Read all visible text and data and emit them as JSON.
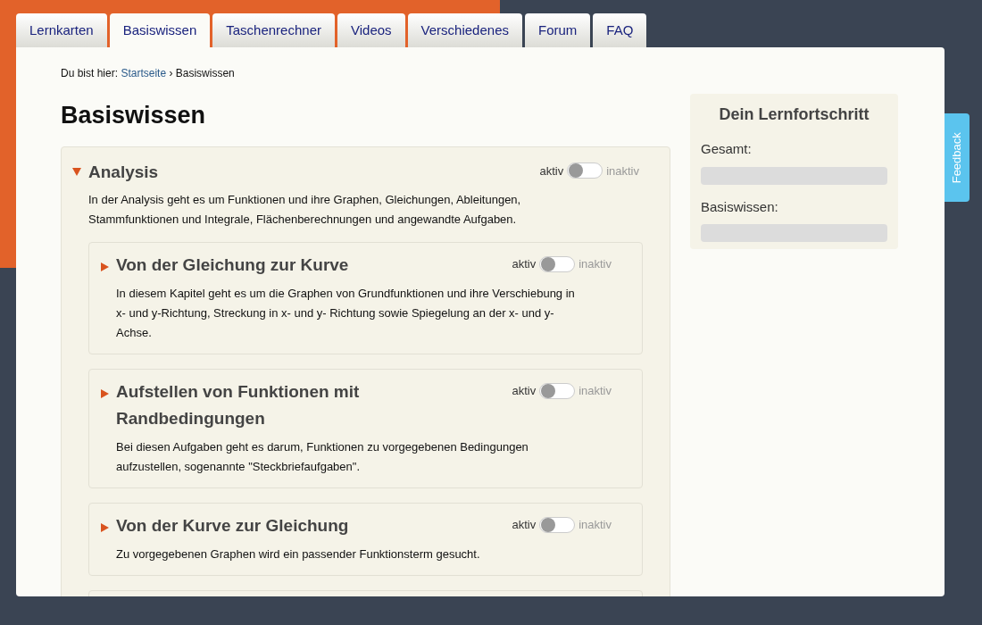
{
  "tabs": [
    {
      "label": "Lernkarten",
      "selected": false
    },
    {
      "label": "Basiswissen",
      "selected": true
    },
    {
      "label": "Taschenrechner",
      "selected": false
    },
    {
      "label": "Videos",
      "selected": false
    },
    {
      "label": "Verschiedenes",
      "selected": false
    },
    {
      "label": "Forum",
      "selected": false
    },
    {
      "label": "FAQ",
      "selected": false
    }
  ],
  "breadcrumb": {
    "prefix": "Du bist hier:",
    "link": "Startseite",
    "separator": "›",
    "current": "Basiswissen"
  },
  "heading": "Basiswissen",
  "topic": {
    "title": "Analysis",
    "expanded": true,
    "toggle": {
      "on_label": "aktiv",
      "off_label": "inaktiv",
      "on": false
    },
    "description": "In der Analysis geht es um Funktionen und ihre Graphen, Gleichungen, Ableitungen, Stammfunktionen und Integrale, Flächenberechnungen und angewandte Aufgaben.",
    "children": [
      {
        "title": "Von der Gleichung zur Kurve",
        "expanded": false,
        "toggle": {
          "on_label": "aktiv",
          "off_label": "inaktiv",
          "on": false
        },
        "description": "In diesem Kapitel geht es um die Graphen von Grundfunktionen und ihre Verschiebung in x- und y-Richtung, Streckung in x- und y- Richtung sowie Spiegelung an der x- und y-Achse."
      },
      {
        "title": "Aufstellen von Funktionen mit Randbedingungen",
        "expanded": false,
        "toggle": {
          "on_label": "aktiv",
          "off_label": "inaktiv",
          "on": false
        },
        "description": "Bei diesen Aufgaben geht es darum, Funktionen zu vorgegebenen Bedingungen aufzustellen, sogenannte \"Steckbriefaufgaben\"."
      },
      {
        "title": "Von der Kurve zur Gleichung",
        "expanded": false,
        "toggle": {
          "on_label": "aktiv",
          "off_label": "inaktiv",
          "on": false
        },
        "description": "Zu vorgegebenen Graphen wird ein passender Funktionsterm gesucht."
      }
    ]
  },
  "progress": {
    "title": "Dein Lernfortschritt",
    "items": [
      {
        "label": "Gesamt:",
        "level": 0
      },
      {
        "label": "Basiswissen:",
        "level": 0
      }
    ]
  },
  "feedback_tab": "Feedback"
}
